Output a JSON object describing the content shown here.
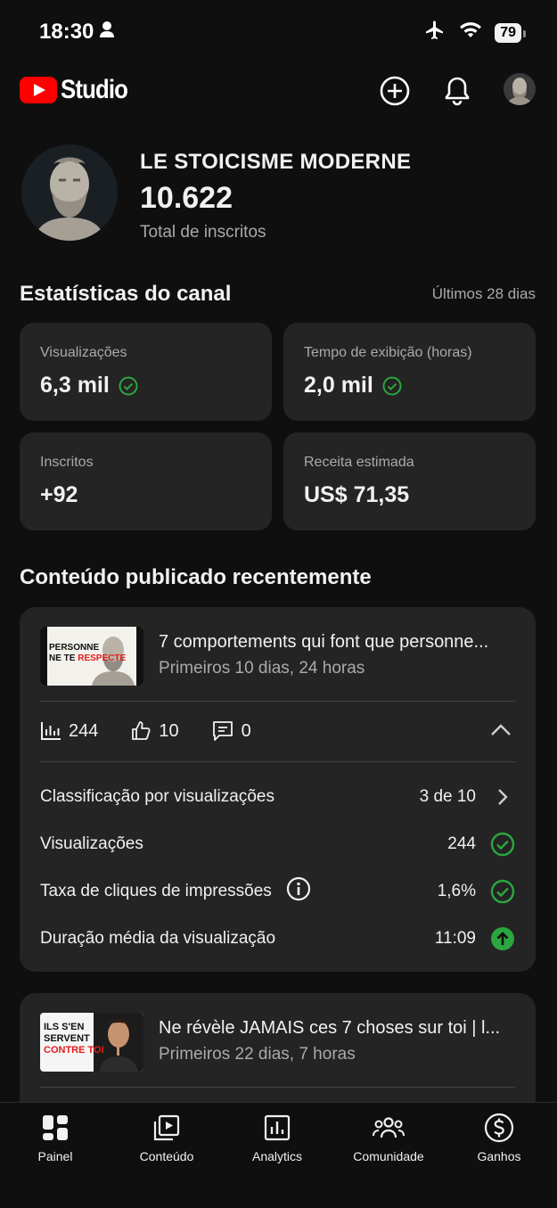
{
  "status_bar": {
    "time": "18:30",
    "battery": "79"
  },
  "header": {
    "logo_text": "Studio"
  },
  "channel": {
    "name": "LE STOICISME MODERNE",
    "subscribers": "10.622",
    "subscribers_label": "Total de inscritos"
  },
  "stats": {
    "title": "Estatísticas do canal",
    "period": "Últimos 28 dias",
    "cards": [
      {
        "label": "Visualizações",
        "value": "6,3 mil"
      },
      {
        "label": "Tempo de exibição (horas)",
        "value": "2,0 mil"
      },
      {
        "label": "Inscritos",
        "value": "+92"
      },
      {
        "label": "Receita estimada",
        "value": "US$ 71,35"
      }
    ]
  },
  "recent": {
    "title": "Conteúdo publicado recentemente",
    "videos": [
      {
        "thumb_line1": "PERSONNE",
        "thumb_line2": "NE TE",
        "thumb_line3": "RESPECTE",
        "title": "7 comportements qui font que personne...",
        "subtitle": "Primeiros 10 dias, 24 horas",
        "views": "244",
        "likes": "10",
        "comments": "0",
        "rows": [
          {
            "label": "Classificação por visualizações",
            "value": "3 de 10"
          },
          {
            "label": "Visualizações",
            "value": "244"
          },
          {
            "label": "Taxa de cliques de impressões",
            "value": "1,6%"
          },
          {
            "label": "Duração média da visualização",
            "value": "11:09"
          }
        ]
      },
      {
        "thumb_line1": "ILS S'EN",
        "thumb_line2": "SERVENT",
        "thumb_line3": "CONTRE TOI",
        "title": "Ne révèle JAMAIS ces 7 choses sur toi | l...",
        "subtitle": "Primeiros 22 dias, 7 horas"
      }
    ]
  },
  "nav": {
    "items": [
      "Painel",
      "Conteúdo",
      "Analytics",
      "Comunidade",
      "Ganhos"
    ]
  },
  "colors": {
    "background": "#0f0f0f",
    "card": "#242424",
    "success": "#2ba640",
    "youtube_red": "#ff0000"
  }
}
